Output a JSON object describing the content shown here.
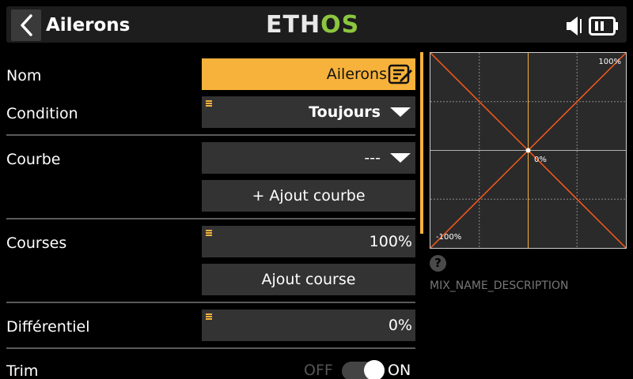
{
  "header": {
    "title": "Ailerons",
    "logo_part1": "ETH",
    "logo_part2": "OS",
    "brand_color": "#8cc63f",
    "accent_color": "#f7b23b"
  },
  "form": {
    "name": {
      "label": "Nom",
      "value": "Ailerons"
    },
    "condition": {
      "label": "Condition",
      "value": "Toujours"
    },
    "curve": {
      "label": "Courbe",
      "value": "---",
      "add_button": "+ Ajout courbe"
    },
    "rates": {
      "label": "Courses",
      "value": "100%",
      "add_button": "Ajout course"
    },
    "differential": {
      "label": "Différentiel",
      "value": "0%"
    },
    "trim": {
      "label": "Trim",
      "off_label": "OFF",
      "on_label": "ON",
      "state": "on"
    }
  },
  "graph": {
    "max_label": "100%",
    "center_label": "0%",
    "min_label": "-100%"
  },
  "help": {
    "icon": "question-icon",
    "description": "MIX_NAME_DESCRIPTION"
  }
}
